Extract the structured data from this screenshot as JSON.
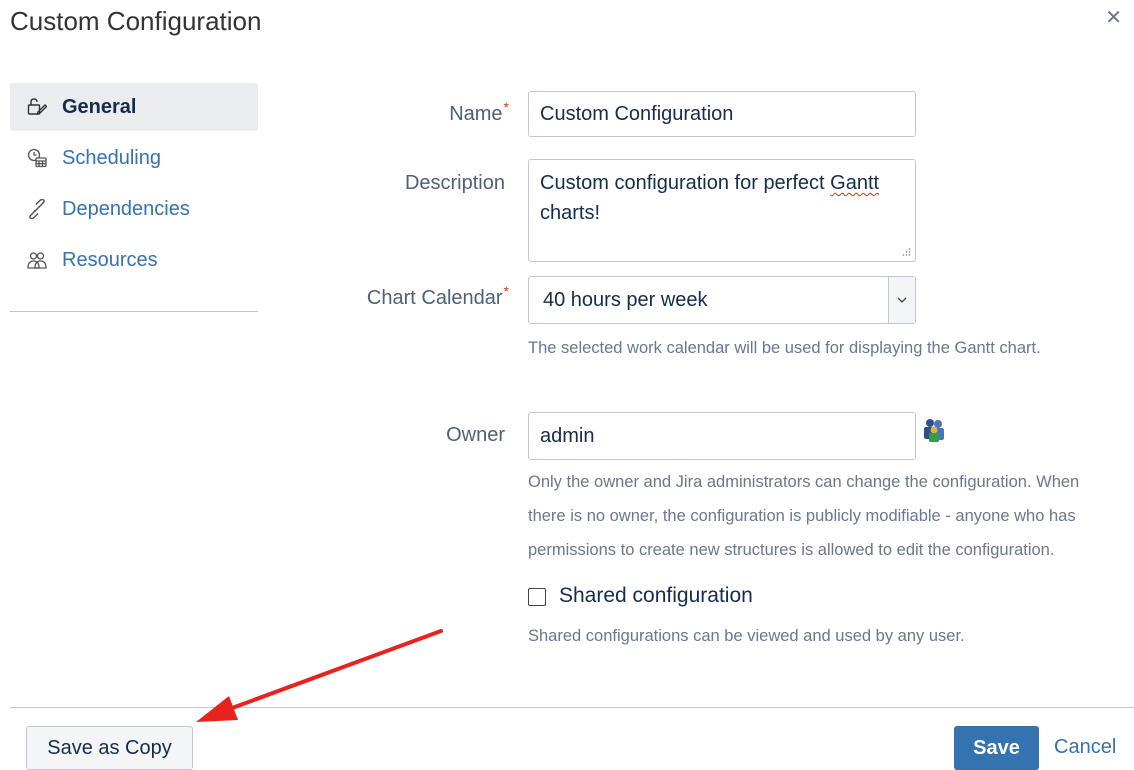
{
  "dialog": {
    "title": "Custom Configuration",
    "close_icon": "close-icon"
  },
  "sidebar": {
    "items": [
      {
        "label": "General",
        "icon": "general-icon",
        "active": true
      },
      {
        "label": "Scheduling",
        "icon": "scheduling-icon",
        "active": false
      },
      {
        "label": "Dependencies",
        "icon": "link-icon",
        "active": false
      },
      {
        "label": "Resources",
        "icon": "resources-icon",
        "active": false
      }
    ]
  },
  "form": {
    "name": {
      "label": "Name",
      "required_mark": "*",
      "value": "Custom Configuration"
    },
    "description": {
      "label": "Description",
      "value_part1": "Custom configuration for perfect ",
      "value_misspelled": "Gantt",
      "value_part2": "charts!"
    },
    "calendar": {
      "label": "Chart Calendar",
      "required_mark": "*",
      "value": "40 hours per week",
      "help": "The selected work calendar will be used for displaying the Gantt chart."
    },
    "owner": {
      "label": "Owner",
      "value": "admin",
      "picker_icon": "user-picker-icon",
      "help_line1": "Only the owner and Jira administrators can change the configuration. When",
      "help_line2": "there is no owner, the configuration is publicly modifiable - anyone who has",
      "help_line3": "permissions to create new structures is allowed to edit the configuration."
    },
    "shared": {
      "label": "Shared configuration",
      "checked": false,
      "help": "Shared configurations can be viewed and used by any user."
    }
  },
  "footer": {
    "save_copy": "Save as Copy",
    "save": "Save",
    "cancel": "Cancel"
  },
  "colors": {
    "accent": "#3572b0",
    "required": "#de350b",
    "annotation_arrow": "#e8231f"
  }
}
